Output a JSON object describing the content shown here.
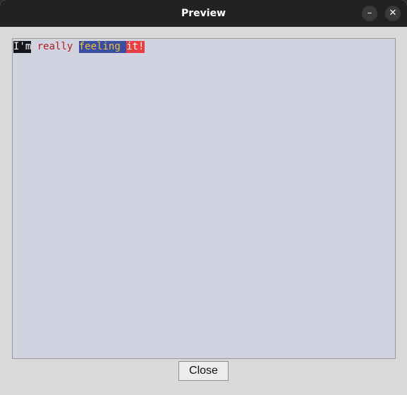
{
  "window": {
    "title": "Preview",
    "minimize_glyph": "–",
    "close_glyph": "✕"
  },
  "preview": {
    "background": "#d1d4e0",
    "segments": [
      {
        "text": "I'm",
        "fg": "#ffffff",
        "bg": "#15151c"
      },
      {
        "text": " ",
        "fg": "#b01c1c",
        "bg": "transparent"
      },
      {
        "text": "really",
        "fg": "#b01c1c",
        "bg": "transparent"
      },
      {
        "text": " ",
        "fg": "#b01c1c",
        "bg": "transparent"
      },
      {
        "text": "feeling",
        "fg": "#f0c040",
        "bg": "#3a4ea0"
      },
      {
        "text": " ",
        "fg": "#f0c040",
        "bg": "#3a4ea0"
      },
      {
        "text": "it!",
        "fg": "#ffffff",
        "bg": "#e84040"
      }
    ]
  },
  "footer": {
    "close_label": "Close"
  }
}
